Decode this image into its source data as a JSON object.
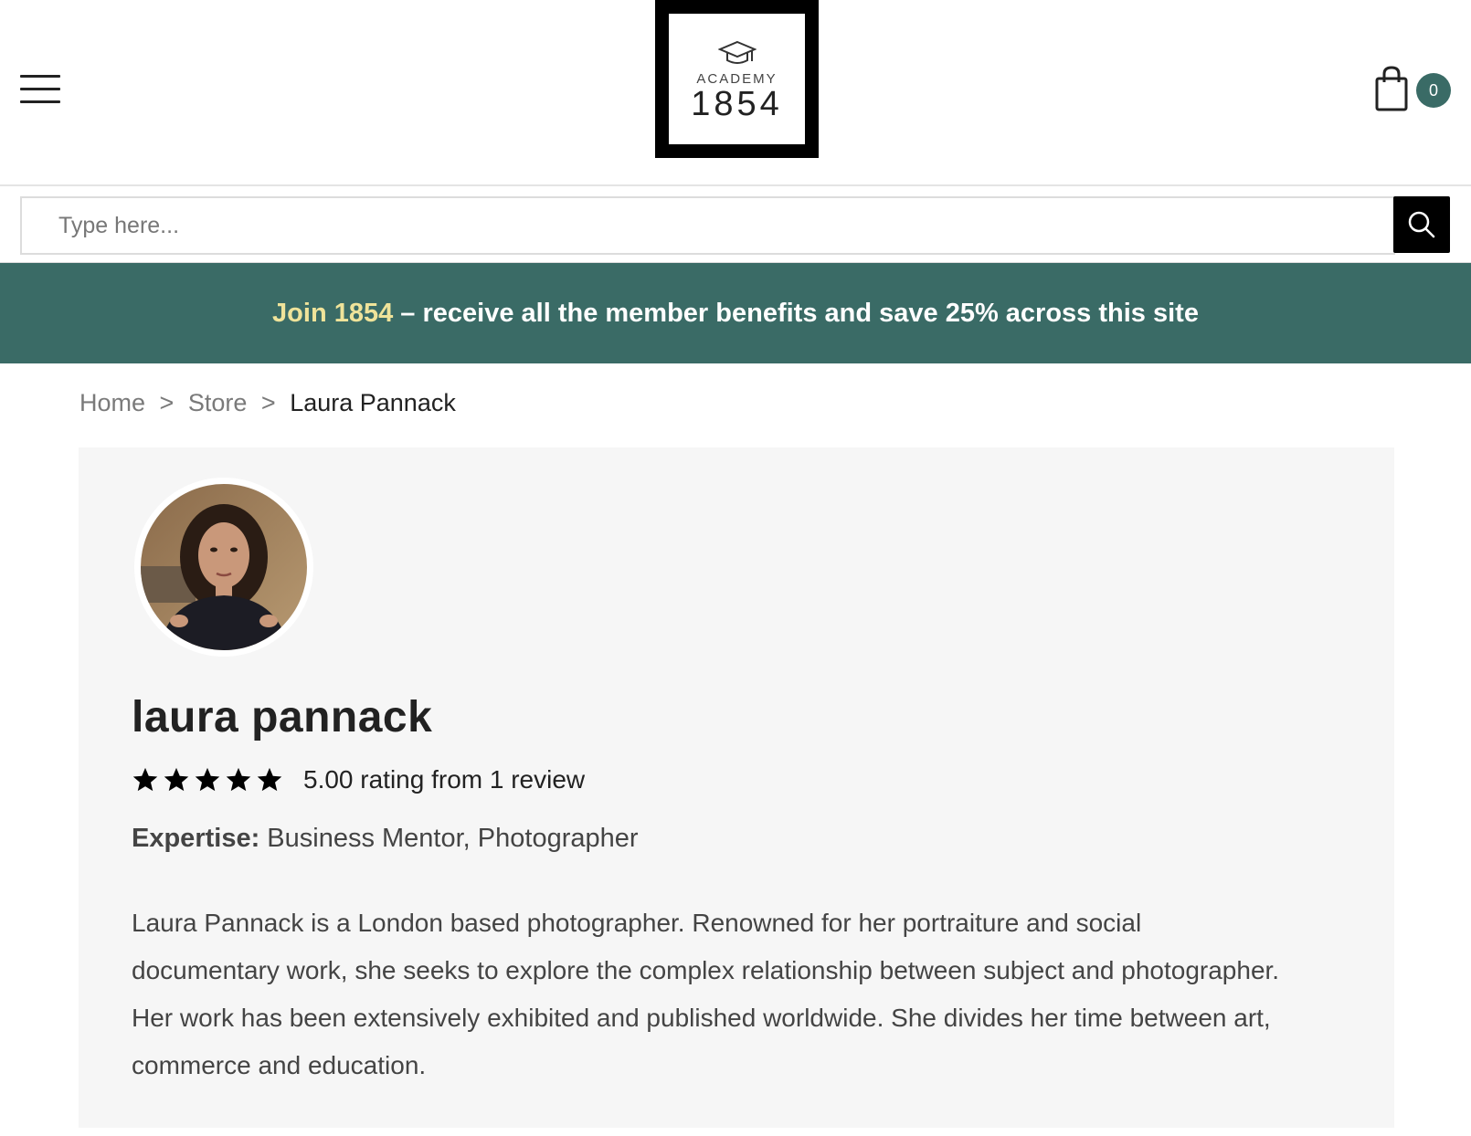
{
  "header": {
    "logo_top": "ACADEMY",
    "logo_year": "1854",
    "cart_count": "0"
  },
  "search": {
    "placeholder": "Type here..."
  },
  "banner": {
    "highlight": "Join 1854",
    "text": " – receive all the member benefits and save 25% across this site"
  },
  "breadcrumb": {
    "home": "Home",
    "store": "Store",
    "current": "Laura Pannack",
    "separator": ">"
  },
  "profile": {
    "name": "laura pannack",
    "rating_value": 5,
    "rating_max": 5,
    "rating_text": "5.00 rating from 1 review",
    "expertise_label": "Expertise:",
    "expertise_value": " Business Mentor, Photographer",
    "bio": "Laura Pannack is a London based photographer. Renowned for her portraiture and social documentary work, she seeks to explore the complex relationship between subject and photographer. Her work has been extensively exhibited and published worldwide. She divides her time between art, commerce and education."
  },
  "colors": {
    "brand_green": "#3a6b66",
    "banner_highlight": "#efe39a",
    "card_bg": "#f6f6f6"
  }
}
